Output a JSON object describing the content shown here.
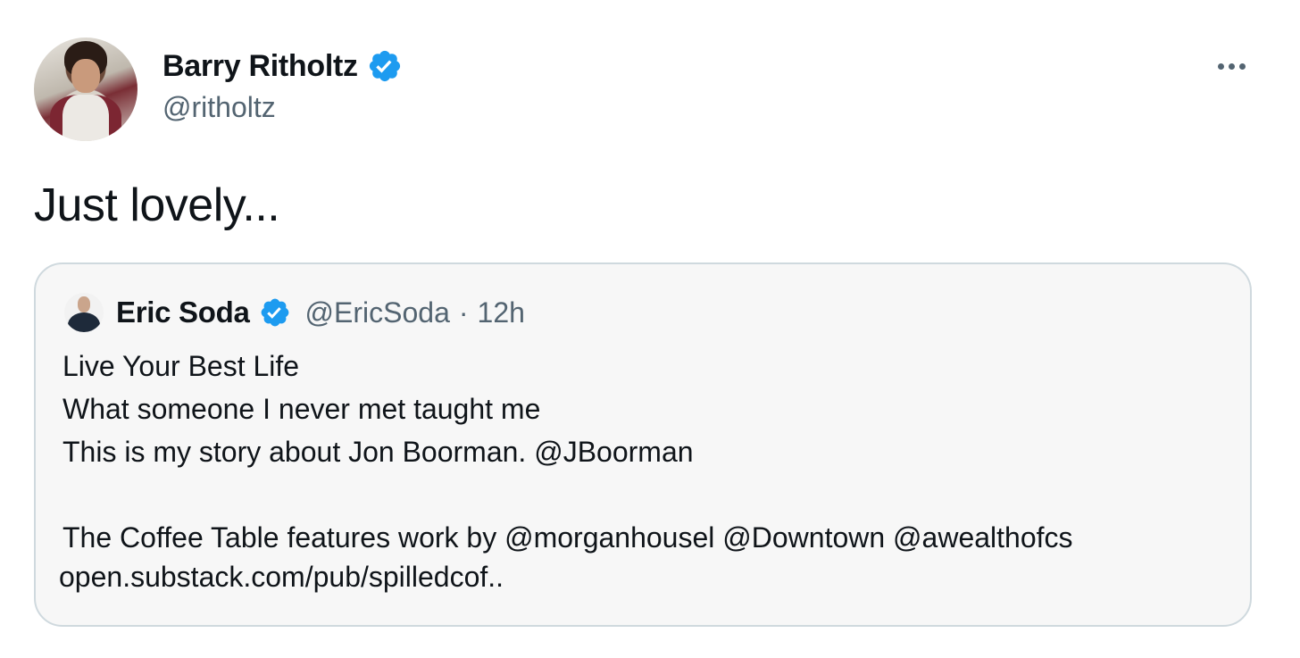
{
  "author": {
    "display_name": "Barry Ritholtz",
    "handle": "@ritholtz",
    "verified_icon": "verified-badge-icon",
    "avatar": "avatar"
  },
  "more_icon": "more-options-icon",
  "tweet": {
    "text": "Just lovely..."
  },
  "quoted_tweet": {
    "display_name": "Eric Soda",
    "handle": "@EricSoda",
    "separator": "·",
    "time": "12h",
    "lines": [
      "Live Your Best Life",
      "What someone I never met taught me",
      "This is my story about Jon Boorman. @JBoorman",
      "",
      "The Coffee Table features work by @morganhousel @Downtown @awealthofcs"
    ],
    "link": "open.substack.com/pub/spilledcof.."
  },
  "colors": {
    "verified_blue": "#1d9bf0",
    "secondary_text": "#536471",
    "card_border": "#cfd9de"
  }
}
